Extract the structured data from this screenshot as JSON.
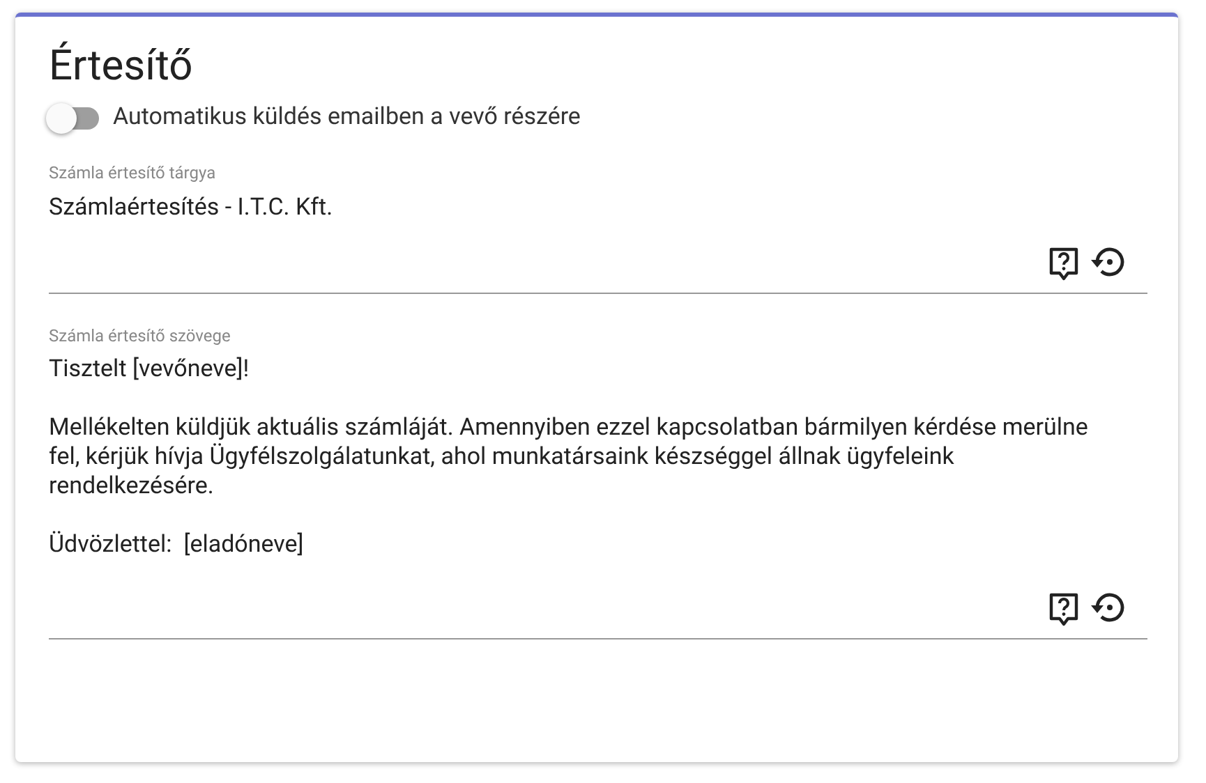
{
  "card": {
    "title": "Értesítő"
  },
  "auto_send": {
    "label": "Automatikus küldés emailben a vevő részére",
    "on": false
  },
  "subject": {
    "label": "Számla értesítő tárgya",
    "value": "Számlaértesítés - I.T.C. Kft."
  },
  "body": {
    "label": "Számla értesítő szövege",
    "paragraphs": [
      "Tisztelt [vevőneve]!",
      "Mellékelten küldjük aktuális számláját. Amennyiben ezzel kapcsolatban bármilyen kérdése merülne fel, kérjük hívja Ügyfélszolgálatunkat, ahol munkatársaink készséggel állnak ügyfeleink rendelkezésére.",
      "Üdvözlettel:  [eladóneve]"
    ]
  }
}
